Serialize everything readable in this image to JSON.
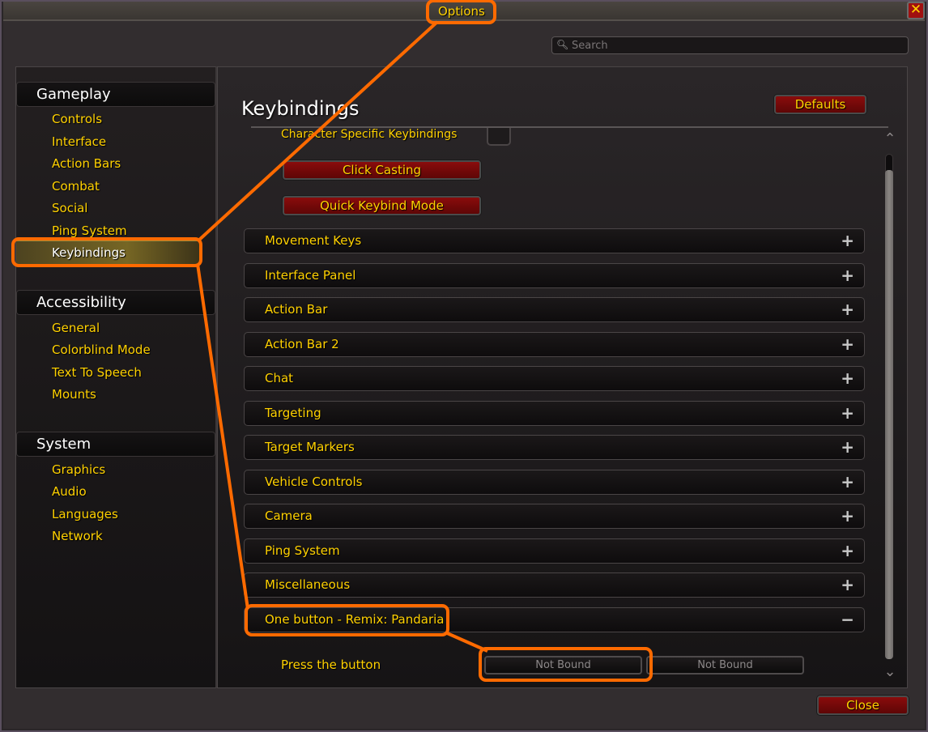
{
  "window": {
    "title": "Options",
    "close_icon": "close-x-icon"
  },
  "search": {
    "placeholder": "Search",
    "value": "",
    "icon": "search-icon"
  },
  "sidebar": {
    "categories": [
      {
        "label": "Gameplay",
        "items": [
          {
            "label": "Controls"
          },
          {
            "label": "Interface"
          },
          {
            "label": "Action Bars"
          },
          {
            "label": "Combat"
          },
          {
            "label": "Social"
          },
          {
            "label": "Ping System"
          },
          {
            "label": "Keybindings",
            "selected": true
          }
        ]
      },
      {
        "label": "Accessibility",
        "items": [
          {
            "label": "General"
          },
          {
            "label": "Colorblind Mode"
          },
          {
            "label": "Text To Speech"
          },
          {
            "label": "Mounts"
          }
        ]
      },
      {
        "label": "System",
        "items": [
          {
            "label": "Graphics"
          },
          {
            "label": "Audio"
          },
          {
            "label": "Languages"
          },
          {
            "label": "Network"
          }
        ]
      }
    ]
  },
  "main": {
    "title": "Keybindings",
    "defaults_label": "Defaults",
    "character_specific_label": "Character Specific Keybindings",
    "character_specific_checked": false,
    "click_casting_label": "Click Casting",
    "quick_keybind_label": "Quick Keybind Mode",
    "sections": [
      {
        "label": "Movement Keys",
        "toggle": "+"
      },
      {
        "label": "Interface Panel",
        "toggle": "+"
      },
      {
        "label": "Action Bar",
        "toggle": "+"
      },
      {
        "label": "Action Bar 2",
        "toggle": "+"
      },
      {
        "label": "Chat",
        "toggle": "+"
      },
      {
        "label": "Targeting",
        "toggle": "+"
      },
      {
        "label": "Target Markers",
        "toggle": "+"
      },
      {
        "label": "Vehicle Controls",
        "toggle": "+"
      },
      {
        "label": "Camera",
        "toggle": "+"
      },
      {
        "label": "Ping System",
        "toggle": "+"
      },
      {
        "label": "Miscellaneous",
        "toggle": "+"
      },
      {
        "label": "One button - Remix: Pandaria",
        "toggle": "−",
        "expanded": true
      }
    ],
    "binding_row": {
      "label": "Press the button",
      "primary": "Not Bound",
      "secondary": "Not Bound"
    },
    "scroll_position_fraction": 0.97
  },
  "footer": {
    "close_label": "Close"
  },
  "annotation": {
    "color": "#ff6a00"
  }
}
